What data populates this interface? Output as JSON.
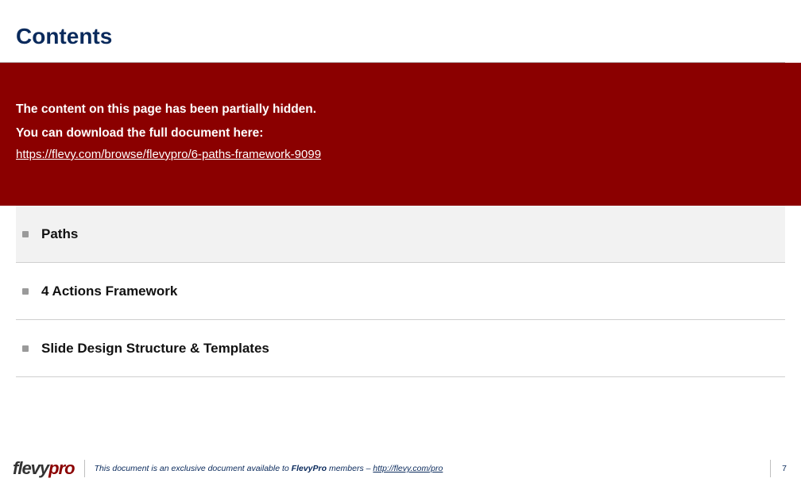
{
  "title": "Contents",
  "banner": {
    "line1": "The content on this page has been partially hidden.",
    "line2": "You can download the full document here:",
    "link_text": "https://flevy.com/browse/flevypro/6-paths-framework-9099",
    "link_href": "https://flevy.com/browse/flevypro/6-paths-framework-9099"
  },
  "items": [
    {
      "label": "Paths",
      "highlight": true
    },
    {
      "label": "4 Actions Framework",
      "highlight": false
    },
    {
      "label": "Slide Design Structure & Templates",
      "highlight": false
    }
  ],
  "footer": {
    "logo_left": "flevy",
    "logo_right": "pro",
    "text_prefix": "This document is an exclusive document available to ",
    "text_bold": "FlevyPro",
    "text_mid": " members – ",
    "link_text": "http://flevy.com/pro",
    "link_href": "http://flevy.com/pro",
    "page_number": "7"
  }
}
